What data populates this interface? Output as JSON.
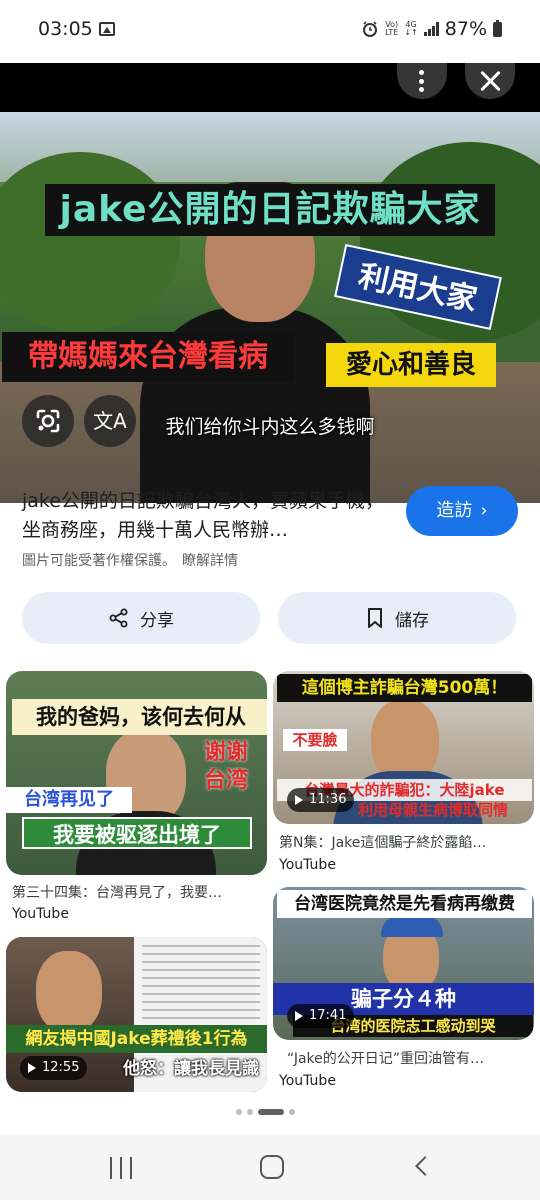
{
  "status_bar": {
    "time": "03:05",
    "network_top": "Vo)",
    "network_bottom": "LTE",
    "data_top": "4G",
    "data_bottom": "↓↑",
    "battery_percent": "87%"
  },
  "viewer": {
    "image_captions": {
      "title": "jake公開的日記欺騙大家",
      "tag1": "利用大家",
      "tag2": "帶媽媽來台灣看病",
      "tag3": "愛心和善良",
      "subtitle": "我们给你斗内这么多钱啊"
    },
    "translate_glyph": "文A"
  },
  "info": {
    "title": "jake公開的日記欺騙台灣人，買蘋果手機，坐商務座，用幾十萬人民幣辦…",
    "visit_label": "造訪",
    "copyright_text": "圖片可能受著作權保護。",
    "learn_more": "瞭解詳情"
  },
  "actions": {
    "share_label": "分享",
    "save_label": "儲存"
  },
  "related": [
    {
      "thumb_lines": [
        "我的爸妈，该何去何从",
        "谢谢",
        "台湾",
        "台湾再见了",
        "我要被驱逐出境了"
      ],
      "duration": "",
      "caption": "第三十四集：台灣再見了，我要…",
      "source": "YouTube"
    },
    {
      "thumb_lines": [
        "這個博主詐騙台灣500萬！",
        "不要臉",
        "台灣最大的詐騙犯：大陸jake",
        "利用母親生病博取同情"
      ],
      "duration": "11:36",
      "caption": "第N集：Jake這個騙子終於露餡…",
      "source": "YouTube"
    },
    {
      "thumb_lines": [
        "網友揭中國Jake葬禮後1行為",
        "他怒：讓我長見識"
      ],
      "duration": "12:55",
      "caption": "",
      "source": ""
    },
    {
      "thumb_lines": [
        "台湾医院竟然是先看病再缴费",
        "骗子分４种",
        "台湾的医院志工感动到哭"
      ],
      "duration": "17:41",
      "caption": "“Jake的公开日记”重回油管有…",
      "source": "YouTube"
    }
  ],
  "colors": {
    "accent": "#1a73e8",
    "action_bg": "#e8eef7"
  }
}
